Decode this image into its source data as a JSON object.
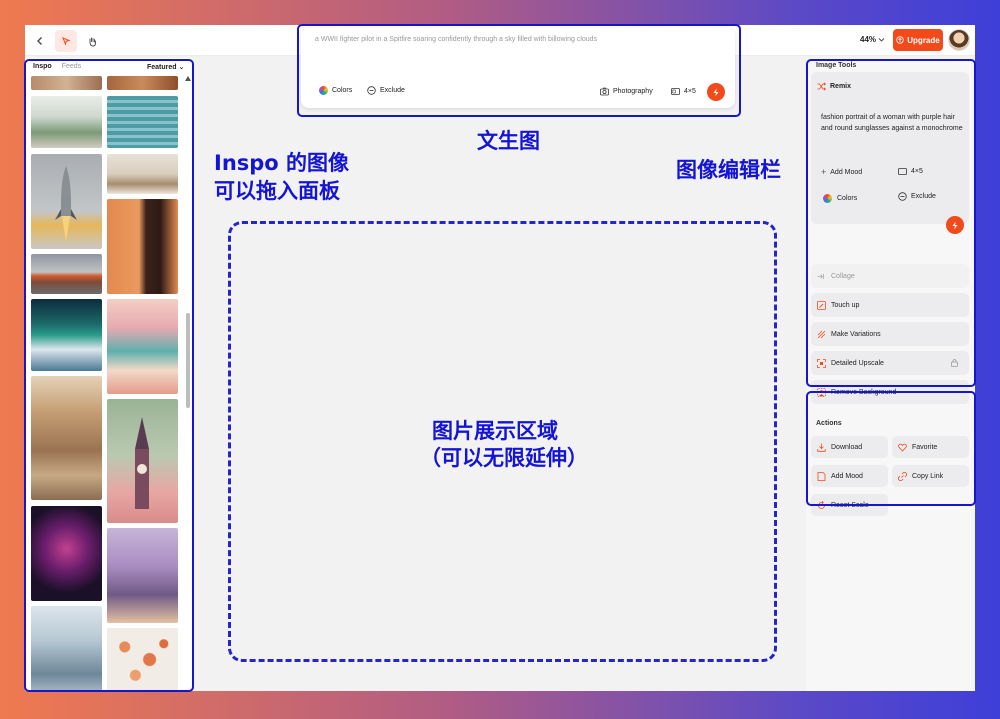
{
  "topbar": {
    "zoom_label": "44%",
    "upgrade_label": "Upgrade"
  },
  "inspo": {
    "tab_inspo": "Inspo",
    "tab_feeds": "Feeds",
    "sort_label": "Featured"
  },
  "prompt": {
    "text": "a WWII fighter pilot in a Spitfire soaring confidently through a sky filled with billowing clouds",
    "colors_label": "Colors",
    "exclude_label": "Exclude",
    "style_label": "Photography",
    "ratio_label": "4×5"
  },
  "tools": {
    "section_title": "Image Tools",
    "remix_label": "Remix",
    "remix_prompt": "fashion portrait of a woman with purple hair and round sunglasses against a monochrome",
    "add_mood_label": "Add Mood",
    "ratio_label": "4×5",
    "colors_label": "Colors",
    "exclude_label": "Exclude",
    "collage_label": "Collage",
    "touch_up_label": "Touch up",
    "variations_label": "Make Variations",
    "upscale_label": "Detailed Upscale",
    "remove_bg_label": "Remove Background"
  },
  "actions": {
    "section_title": "Actions",
    "download_label": "Download",
    "favorite_label": "Favorite",
    "add_mood_label": "Add Mood",
    "copy_link_label": "Copy Link",
    "reset_scale_label": "Reset Scale"
  },
  "annotations": {
    "inspo_line1": "Inspo 的图像",
    "inspo_line2": "可以拖入面板",
    "text_to_image": "文生图",
    "edit_bar": "图像编辑栏",
    "canvas_line1": "图片展示区域",
    "canvas_line2": "（可以无限延伸）"
  },
  "colors": {
    "accent": "#f24a1b",
    "annotation": "#1717c9"
  }
}
